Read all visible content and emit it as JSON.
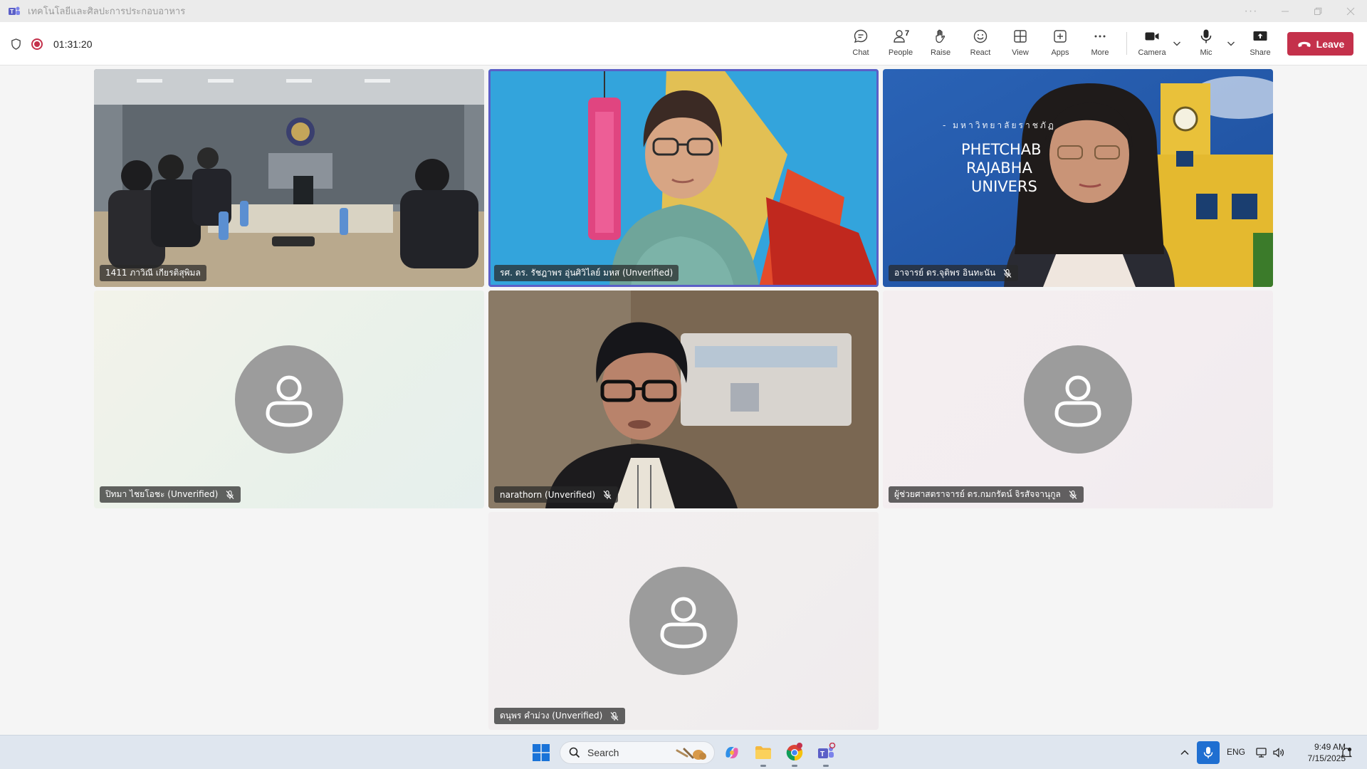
{
  "window": {
    "title": "เทคโนโลยีและศิลปะการประกอบอาหาร",
    "controls": [
      "more-options",
      "minimize",
      "restore",
      "close"
    ]
  },
  "meeting": {
    "duration": "01:31:20",
    "recording": true
  },
  "toolbar": {
    "chat": "Chat",
    "people": "People",
    "people_count": "7",
    "raise": "Raise",
    "react": "React",
    "view": "View",
    "apps": "Apps",
    "more": "More",
    "camera": "Camera",
    "mic": "Mic",
    "share": "Share",
    "leave": "Leave"
  },
  "participants": [
    {
      "name": "1411 ภาวิณี เกียรติสุพิมล",
      "video": true,
      "muted": false,
      "active": false
    },
    {
      "name": "รศ. ดร. รัชฎาพร อุ่นศิวิไลย์ มหส (Unverified)",
      "video": true,
      "muted": false,
      "active": true
    },
    {
      "name": "อาจารย์ ดร.จุติพร อินทะนัน",
      "video": true,
      "muted": true,
      "active": false
    },
    {
      "name": "ปิทมา ไชยโอชะ (Unverified)",
      "video": false,
      "muted": true,
      "active": false
    },
    {
      "name": "narathorn (Unverified)",
      "video": true,
      "muted": true,
      "active": false
    },
    {
      "name": "ผู้ช่วยศาสตราจารย์ ดร.กมกรัตน์ จิรสัจจานุกูล",
      "video": false,
      "muted": true,
      "active": false
    },
    {
      "name": "ดนุพร คำม่วง (Unverified)",
      "video": false,
      "muted": true,
      "active": false
    }
  ],
  "backdrop_text": {
    "line0": "- มหาวิทยาลัยราชภัฏ",
    "line1": "PHETCHAB",
    "line2": "RAJABHA",
    "line3": "UNIVERS"
  },
  "taskbar": {
    "search_placeholder": "Search",
    "language": "ENG",
    "time": "9:49 AM",
    "date": "7/15/2025"
  },
  "colors": {
    "accent": "#5b5fc7",
    "leave": "#c4314b",
    "avatar": "#9c9c9c"
  }
}
